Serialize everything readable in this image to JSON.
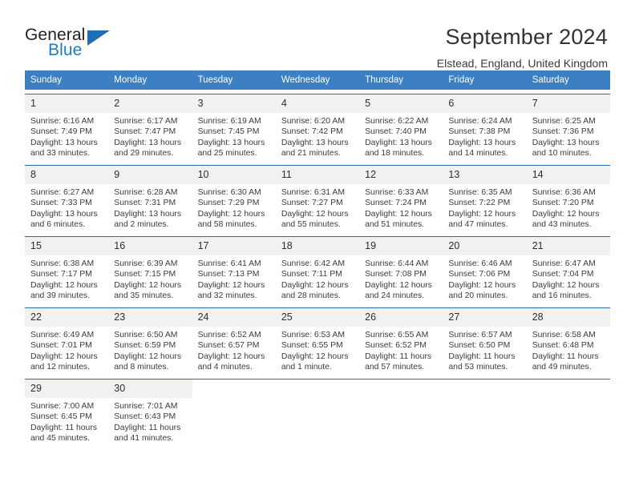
{
  "brand": {
    "name_top": "General",
    "name_bottom": "Blue",
    "triangle_color": "#1f6fb8",
    "blue_text_color": "#1d7dc1"
  },
  "header": {
    "title": "September 2024",
    "subtitle": "Elstead, England, United Kingdom"
  },
  "theme": {
    "header_bg": "#3c7fc2",
    "row_border": "#2a6cb0",
    "daynum_bg": "#f1f1f1"
  },
  "labels": {
    "sunrise_prefix": "Sunrise:",
    "sunset_prefix": "Sunset:",
    "daylight_prefix": "Daylight:"
  },
  "weekdays": [
    "Sunday",
    "Monday",
    "Tuesday",
    "Wednesday",
    "Thursday",
    "Friday",
    "Saturday"
  ],
  "weeks": [
    [
      {
        "day": "1",
        "sunrise": "Sunrise: 6:16 AM",
        "sunset": "Sunset: 7:49 PM",
        "daylight1": "Daylight: 13 hours",
        "daylight2": "and 33 minutes."
      },
      {
        "day": "2",
        "sunrise": "Sunrise: 6:17 AM",
        "sunset": "Sunset: 7:47 PM",
        "daylight1": "Daylight: 13 hours",
        "daylight2": "and 29 minutes."
      },
      {
        "day": "3",
        "sunrise": "Sunrise: 6:19 AM",
        "sunset": "Sunset: 7:45 PM",
        "daylight1": "Daylight: 13 hours",
        "daylight2": "and 25 minutes."
      },
      {
        "day": "4",
        "sunrise": "Sunrise: 6:20 AM",
        "sunset": "Sunset: 7:42 PM",
        "daylight1": "Daylight: 13 hours",
        "daylight2": "and 21 minutes."
      },
      {
        "day": "5",
        "sunrise": "Sunrise: 6:22 AM",
        "sunset": "Sunset: 7:40 PM",
        "daylight1": "Daylight: 13 hours",
        "daylight2": "and 18 minutes."
      },
      {
        "day": "6",
        "sunrise": "Sunrise: 6:24 AM",
        "sunset": "Sunset: 7:38 PM",
        "daylight1": "Daylight: 13 hours",
        "daylight2": "and 14 minutes."
      },
      {
        "day": "7",
        "sunrise": "Sunrise: 6:25 AM",
        "sunset": "Sunset: 7:36 PM",
        "daylight1": "Daylight: 13 hours",
        "daylight2": "and 10 minutes."
      }
    ],
    [
      {
        "day": "8",
        "sunrise": "Sunrise: 6:27 AM",
        "sunset": "Sunset: 7:33 PM",
        "daylight1": "Daylight: 13 hours",
        "daylight2": "and 6 minutes."
      },
      {
        "day": "9",
        "sunrise": "Sunrise: 6:28 AM",
        "sunset": "Sunset: 7:31 PM",
        "daylight1": "Daylight: 13 hours",
        "daylight2": "and 2 minutes."
      },
      {
        "day": "10",
        "sunrise": "Sunrise: 6:30 AM",
        "sunset": "Sunset: 7:29 PM",
        "daylight1": "Daylight: 12 hours",
        "daylight2": "and 58 minutes."
      },
      {
        "day": "11",
        "sunrise": "Sunrise: 6:31 AM",
        "sunset": "Sunset: 7:27 PM",
        "daylight1": "Daylight: 12 hours",
        "daylight2": "and 55 minutes."
      },
      {
        "day": "12",
        "sunrise": "Sunrise: 6:33 AM",
        "sunset": "Sunset: 7:24 PM",
        "daylight1": "Daylight: 12 hours",
        "daylight2": "and 51 minutes."
      },
      {
        "day": "13",
        "sunrise": "Sunrise: 6:35 AM",
        "sunset": "Sunset: 7:22 PM",
        "daylight1": "Daylight: 12 hours",
        "daylight2": "and 47 minutes."
      },
      {
        "day": "14",
        "sunrise": "Sunrise: 6:36 AM",
        "sunset": "Sunset: 7:20 PM",
        "daylight1": "Daylight: 12 hours",
        "daylight2": "and 43 minutes."
      }
    ],
    [
      {
        "day": "15",
        "sunrise": "Sunrise: 6:38 AM",
        "sunset": "Sunset: 7:17 PM",
        "daylight1": "Daylight: 12 hours",
        "daylight2": "and 39 minutes."
      },
      {
        "day": "16",
        "sunrise": "Sunrise: 6:39 AM",
        "sunset": "Sunset: 7:15 PM",
        "daylight1": "Daylight: 12 hours",
        "daylight2": "and 35 minutes."
      },
      {
        "day": "17",
        "sunrise": "Sunrise: 6:41 AM",
        "sunset": "Sunset: 7:13 PM",
        "daylight1": "Daylight: 12 hours",
        "daylight2": "and 32 minutes."
      },
      {
        "day": "18",
        "sunrise": "Sunrise: 6:42 AM",
        "sunset": "Sunset: 7:11 PM",
        "daylight1": "Daylight: 12 hours",
        "daylight2": "and 28 minutes."
      },
      {
        "day": "19",
        "sunrise": "Sunrise: 6:44 AM",
        "sunset": "Sunset: 7:08 PM",
        "daylight1": "Daylight: 12 hours",
        "daylight2": "and 24 minutes."
      },
      {
        "day": "20",
        "sunrise": "Sunrise: 6:46 AM",
        "sunset": "Sunset: 7:06 PM",
        "daylight1": "Daylight: 12 hours",
        "daylight2": "and 20 minutes."
      },
      {
        "day": "21",
        "sunrise": "Sunrise: 6:47 AM",
        "sunset": "Sunset: 7:04 PM",
        "daylight1": "Daylight: 12 hours",
        "daylight2": "and 16 minutes."
      }
    ],
    [
      {
        "day": "22",
        "sunrise": "Sunrise: 6:49 AM",
        "sunset": "Sunset: 7:01 PM",
        "daylight1": "Daylight: 12 hours",
        "daylight2": "and 12 minutes."
      },
      {
        "day": "23",
        "sunrise": "Sunrise: 6:50 AM",
        "sunset": "Sunset: 6:59 PM",
        "daylight1": "Daylight: 12 hours",
        "daylight2": "and 8 minutes."
      },
      {
        "day": "24",
        "sunrise": "Sunrise: 6:52 AM",
        "sunset": "Sunset: 6:57 PM",
        "daylight1": "Daylight: 12 hours",
        "daylight2": "and 4 minutes."
      },
      {
        "day": "25",
        "sunrise": "Sunrise: 6:53 AM",
        "sunset": "Sunset: 6:55 PM",
        "daylight1": "Daylight: 12 hours",
        "daylight2": "and 1 minute."
      },
      {
        "day": "26",
        "sunrise": "Sunrise: 6:55 AM",
        "sunset": "Sunset: 6:52 PM",
        "daylight1": "Daylight: 11 hours",
        "daylight2": "and 57 minutes."
      },
      {
        "day": "27",
        "sunrise": "Sunrise: 6:57 AM",
        "sunset": "Sunset: 6:50 PM",
        "daylight1": "Daylight: 11 hours",
        "daylight2": "and 53 minutes."
      },
      {
        "day": "28",
        "sunrise": "Sunrise: 6:58 AM",
        "sunset": "Sunset: 6:48 PM",
        "daylight1": "Daylight: 11 hours",
        "daylight2": "and 49 minutes."
      }
    ],
    [
      {
        "day": "29",
        "sunrise": "Sunrise: 7:00 AM",
        "sunset": "Sunset: 6:45 PM",
        "daylight1": "Daylight: 11 hours",
        "daylight2": "and 45 minutes."
      },
      {
        "day": "30",
        "sunrise": "Sunrise: 7:01 AM",
        "sunset": "Sunset: 6:43 PM",
        "daylight1": "Daylight: 11 hours",
        "daylight2": "and 41 minutes."
      },
      {
        "day": "",
        "sunrise": "",
        "sunset": "",
        "daylight1": "",
        "daylight2": ""
      },
      {
        "day": "",
        "sunrise": "",
        "sunset": "",
        "daylight1": "",
        "daylight2": ""
      },
      {
        "day": "",
        "sunrise": "",
        "sunset": "",
        "daylight1": "",
        "daylight2": ""
      },
      {
        "day": "",
        "sunrise": "",
        "sunset": "",
        "daylight1": "",
        "daylight2": ""
      },
      {
        "day": "",
        "sunrise": "",
        "sunset": "",
        "daylight1": "",
        "daylight2": ""
      }
    ]
  ]
}
